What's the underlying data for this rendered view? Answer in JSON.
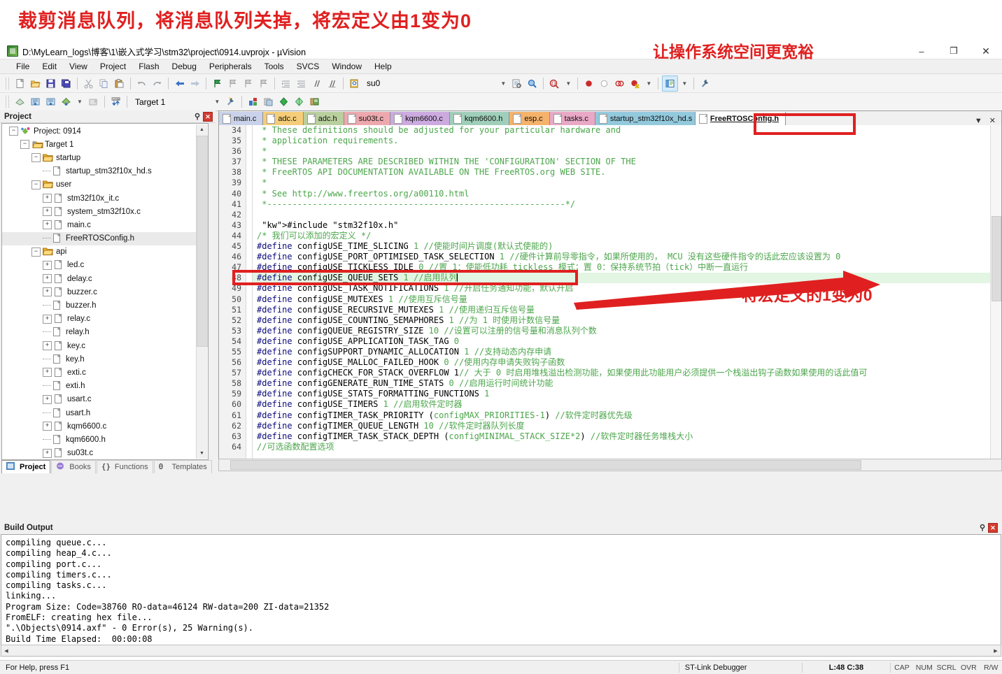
{
  "annotations": {
    "top_note": "裁剪消息队列，将消息队列关掉，将宏定义由1变为0",
    "title_note": "让操作系统空间更宽裕",
    "code_note": "将宏定义的1变为0"
  },
  "window": {
    "title": "D:\\MyLearn_logs\\博客\\1\\嵌入式学习\\stm32\\project\\0914.uvprojx - µVision",
    "icon": "uvision-icon",
    "minimize": "–",
    "maximize": "❐",
    "close": "✕"
  },
  "menu": {
    "items": [
      "File",
      "Edit",
      "View",
      "Project",
      "Flash",
      "Debug",
      "Peripherals",
      "Tools",
      "SVCS",
      "Window",
      "Help"
    ]
  },
  "toolbar1": {
    "find_combo_value": "su0",
    "icons": [
      "new-file-icon",
      "open-file-icon",
      "save-icon",
      "save-all-icon",
      "cut-icon",
      "copy-icon",
      "paste-icon",
      "undo-icon",
      "redo-icon",
      "navigate-back-icon",
      "navigate-forward-icon",
      "bookmark-toggle-icon",
      "bookmark-prev-icon",
      "bookmark-next-icon",
      "bookmark-clear-icon",
      "indent-icon",
      "outdent-icon",
      "comment-icon",
      "uncomment-icon",
      "find-in-files-icon",
      "find-combo-icon",
      "incremental-find-icon",
      "find-next-icon",
      "insert-breakpoint-icon",
      "enable-breakpoint-icon",
      "disable-all-breakpoints-icon",
      "kill-all-breakpoints-icon",
      "project-window-icon",
      "configuration-wizard-icon"
    ]
  },
  "toolbar2": {
    "target_value": "Target 1",
    "icons": [
      "translate-icon",
      "build-icon",
      "rebuild-icon",
      "batch-build-icon",
      "stop-build-icon",
      "download-icon",
      "target-options-icon",
      "manage-components-icon",
      "multi-project-icon",
      "pack-installer-icon",
      "pack-manager-icon",
      "books-icon"
    ]
  },
  "project_panel": {
    "title": "Project",
    "pin": "pin-icon",
    "close": "close-icon",
    "tabs": [
      {
        "label": "Project",
        "icon": "project-icon",
        "selected": true
      },
      {
        "label": "Books",
        "icon": "books-icon",
        "selected": false
      },
      {
        "label": "Functions",
        "icon": "functions-icon",
        "selected": false
      },
      {
        "label": "Templates",
        "icon": "templates-icon",
        "selected": false
      }
    ],
    "tree": [
      {
        "label": "Project: 0914",
        "indent": 0,
        "expander": "minus",
        "icon": "project-root-icon"
      },
      {
        "label": "Target 1",
        "indent": 1,
        "expander": "minus",
        "icon": "target-icon"
      },
      {
        "label": "startup",
        "indent": 2,
        "expander": "minus",
        "icon": "folder-icon"
      },
      {
        "label": "startup_stm32f10x_hd.s",
        "indent": 3,
        "expander": "none",
        "icon": "file-icon"
      },
      {
        "label": "user",
        "indent": 2,
        "expander": "minus",
        "icon": "folder-icon"
      },
      {
        "label": "stm32f10x_it.c",
        "indent": 3,
        "expander": "plus",
        "icon": "file-icon"
      },
      {
        "label": "system_stm32f10x.c",
        "indent": 3,
        "expander": "plus",
        "icon": "file-icon"
      },
      {
        "label": "main.c",
        "indent": 3,
        "expander": "plus",
        "icon": "file-icon"
      },
      {
        "label": "FreeRTOSConfig.h",
        "indent": 3,
        "expander": "none",
        "icon": "file-icon",
        "selected": true
      },
      {
        "label": "api",
        "indent": 2,
        "expander": "minus",
        "icon": "folder-icon"
      },
      {
        "label": "led.c",
        "indent": 3,
        "expander": "plus",
        "icon": "file-icon"
      },
      {
        "label": "delay.c",
        "indent": 3,
        "expander": "plus",
        "icon": "file-icon"
      },
      {
        "label": "buzzer.c",
        "indent": 3,
        "expander": "plus",
        "icon": "file-icon"
      },
      {
        "label": "buzzer.h",
        "indent": 3,
        "expander": "none",
        "icon": "file-icon"
      },
      {
        "label": "relay.c",
        "indent": 3,
        "expander": "plus",
        "icon": "file-icon"
      },
      {
        "label": "relay.h",
        "indent": 3,
        "expander": "none",
        "icon": "file-icon"
      },
      {
        "label": "key.c",
        "indent": 3,
        "expander": "plus",
        "icon": "file-icon"
      },
      {
        "label": "key.h",
        "indent": 3,
        "expander": "none",
        "icon": "file-icon"
      },
      {
        "label": "exti.c",
        "indent": 3,
        "expander": "plus",
        "icon": "file-icon"
      },
      {
        "label": "exti.h",
        "indent": 3,
        "expander": "none",
        "icon": "file-icon"
      },
      {
        "label": "usart.c",
        "indent": 3,
        "expander": "plus",
        "icon": "file-icon"
      },
      {
        "label": "usart.h",
        "indent": 3,
        "expander": "none",
        "icon": "file-icon"
      },
      {
        "label": "kqm6600.c",
        "indent": 3,
        "expander": "plus",
        "icon": "file-icon"
      },
      {
        "label": "kqm6600.h",
        "indent": 3,
        "expander": "none",
        "icon": "file-icon"
      },
      {
        "label": "su03t.c",
        "indent": 3,
        "expander": "plus",
        "icon": "file-icon"
      }
    ]
  },
  "editor": {
    "tabs": [
      {
        "label": "main.c",
        "color": "#c9d2ea"
      },
      {
        "label": "adc.c",
        "color": "#f5cd78"
      },
      {
        "label": "adc.h",
        "color": "#b9cf9e"
      },
      {
        "label": "su03t.c",
        "color": "#eda8ae"
      },
      {
        "label": "kqm6600.c",
        "color": "#ccaae0"
      },
      {
        "label": "kqm6600.h",
        "color": "#9fcfba"
      },
      {
        "label": "esp.c",
        "color": "#f5b26b"
      },
      {
        "label": "tasks.c",
        "color": "#e9a8c6"
      },
      {
        "label": "startup_stm32f10x_hd.s",
        "color": "#93c9dd"
      },
      {
        "label": "FreeRTOSConfig.h",
        "color": "#ffffff",
        "current": true
      }
    ],
    "tabbar_menu_icon": "chevron-down-icon",
    "tabbar_close_icon": "close-icon",
    "first_line": 34,
    "lines": [
      {
        "n": 34,
        "text": " * These definitions should be adjusted for your particular hardware and",
        "cls": "cmt"
      },
      {
        "n": 35,
        "text": " * application requirements.",
        "cls": "cmt"
      },
      {
        "n": 36,
        "text": " *",
        "cls": "cmt"
      },
      {
        "n": 37,
        "text": " * THESE PARAMETERS ARE DESCRIBED WITHIN THE 'CONFIGURATION' SECTION OF THE",
        "cls": "cmt"
      },
      {
        "n": 38,
        "text": " * FreeRTOS API DOCUMENTATION AVAILABLE ON THE FreeRTOS.org WEB SITE.",
        "cls": "cmt"
      },
      {
        "n": 39,
        "text": " *",
        "cls": "cmt"
      },
      {
        "n": 40,
        "text": " * See http://www.freertos.org/a00110.html",
        "cls": "cmt"
      },
      {
        "n": 41,
        "text": " *-----------------------------------------------------------*/",
        "cls": "cmt"
      },
      {
        "n": 42,
        "text": "",
        "cls": "plain"
      },
      {
        "n": 43,
        "text": " #include \"stm32f10x.h\"",
        "cls": "inc"
      },
      {
        "n": 44,
        "text": "/* 我们可以添加的宏定义 */",
        "cls": "cmt"
      },
      {
        "n": 45,
        "text": "#define configUSE_TIME_SLICING 1 //使能时间片调度(默认式使能的)",
        "cls": "def"
      },
      {
        "n": 46,
        "text": "#define configUSE_PORT_OPTIMISED_TASK_SELECTION 1 //硬件计算前导零指令，如果所使用的， MCU 没有这些硬件指令的话此宏应该设置为 0",
        "cls": "def"
      },
      {
        "n": 47,
        "text": "#define configUSE_TICKLESS_IDLE 0 //置 1：使能低功耗 tickless 模式；置 0：保持系统节拍（tick）中断一直运行",
        "cls": "def"
      },
      {
        "n": 48,
        "text": "#define configUSE_QUEUE_SETS 1 //启用队列",
        "cls": "def",
        "highlight": true,
        "caret": true
      },
      {
        "n": 49,
        "text": "#define configUSE_TASK_NOTIFICATIONS 1 //开启任务通知功能，默认开启",
        "cls": "def"
      },
      {
        "n": 50,
        "text": "#define configUSE_MUTEXES 1 //使用互斥信号量",
        "cls": "def"
      },
      {
        "n": 51,
        "text": "#define configUSE_RECURSIVE_MUTEXES 1 //使用递归互斥信号量",
        "cls": "def"
      },
      {
        "n": 52,
        "text": "#define configUSE_COUNTING_SEMAPHORES 1 //为 1 时使用计数信号量",
        "cls": "def"
      },
      {
        "n": 53,
        "text": "#define configQUEUE_REGISTRY_SIZE 10 //设置可以注册的信号量和消息队列个数",
        "cls": "def"
      },
      {
        "n": 54,
        "text": "#define configUSE_APPLICATION_TASK_TAG 0",
        "cls": "def"
      },
      {
        "n": 55,
        "text": "#define configSUPPORT_DYNAMIC_ALLOCATION 1 //支持动态内存申请",
        "cls": "def"
      },
      {
        "n": 56,
        "text": "#define configUSE_MALLOC_FAILED_HOOK 0 //使用内存申请失败钩子函数",
        "cls": "def"
      },
      {
        "n": 57,
        "text": "#define configCHECK_FOR_STACK_OVERFLOW 1// 大于 0 时启用堆栈溢出检测功能，如果使用此功能用户必须提供一个栈溢出钩子函数如果使用的话此值可",
        "cls": "def"
      },
      {
        "n": 58,
        "text": "#define configGENERATE_RUN_TIME_STATS 0 //启用运行时间统计功能",
        "cls": "def"
      },
      {
        "n": 59,
        "text": "#define configUSE_STATS_FORMATTING_FUNCTIONS 1",
        "cls": "def"
      },
      {
        "n": 60,
        "text": "#define configUSE_TIMERS 1 //启用软件定时器",
        "cls": "def"
      },
      {
        "n": 61,
        "text": "#define configTIMER_TASK_PRIORITY (configMAX_PRIORITIES-1) //软件定时器优先级",
        "cls": "def"
      },
      {
        "n": 62,
        "text": "#define configTIMER_QUEUE_LENGTH 10 //软件定时器队列长度",
        "cls": "def"
      },
      {
        "n": 63,
        "text": "#define configTIMER_TASK_STACK_DEPTH (configMINIMAL_STACK_SIZE*2) //软件定时器任务堆栈大小",
        "cls": "def"
      },
      {
        "n": 64,
        "text": "//可选函数配置选项",
        "cls": "cmt"
      }
    ]
  },
  "build_output": {
    "title": "Build Output",
    "lines": [
      "compiling queue.c...",
      "compiling heap_4.c...",
      "compiling port.c...",
      "compiling timers.c...",
      "compiling tasks.c...",
      "linking...",
      "Program Size: Code=38760 RO-data=46124 RW-data=200 ZI-data=21352",
      "FromELF: creating hex file...",
      "\".\\Objects\\0914.axf\" - 0 Error(s), 25 Warning(s).",
      "Build Time Elapsed:  00:00:08"
    ],
    "pin": "pin-icon",
    "close": "close-icon"
  },
  "status_bar": {
    "help": "For Help, press F1",
    "debugger": "ST-Link Debugger",
    "position": "L:48 C:38",
    "indicators": [
      "CAP",
      "NUM",
      "SCRL",
      "OVR",
      "R/W"
    ]
  },
  "colors": {
    "accent_red": "#e02020",
    "highlight_line": "#e3f5e3",
    "comment_green": "#4ca64c",
    "keyword_blue": "#0b0b7a"
  }
}
